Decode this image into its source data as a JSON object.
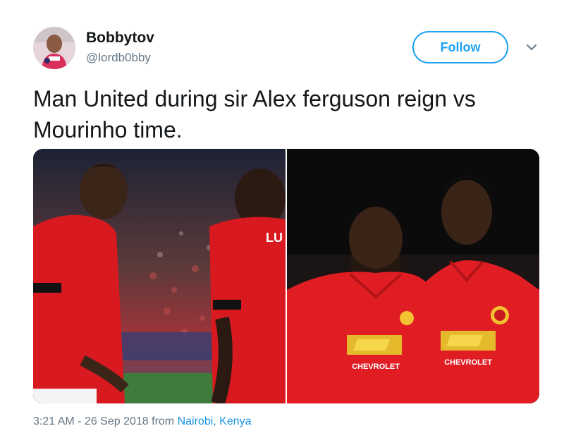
{
  "user": {
    "display_name": "Bobbytov",
    "handle": "@lordb0bby"
  },
  "follow_button": {
    "label": "Follow"
  },
  "tweet": {
    "text": "Man United during sir Alex ferguson reign vs Mourinho time."
  },
  "media": {
    "left_photo": {
      "jersey_lettering": "LU"
    },
    "right_photo": {
      "sponsor_left": "CHEVROLET",
      "sponsor_right": "CHEVROLET"
    }
  },
  "footer": {
    "timestamp": "3:21 AM - 26 Sep 2018",
    "from_label": "from",
    "location": "Nairobi, Kenya"
  },
  "colors": {
    "accent": "#1da1f2",
    "link": "#1b95e0",
    "muted": "#657786",
    "jersey_red": "#d81920"
  }
}
